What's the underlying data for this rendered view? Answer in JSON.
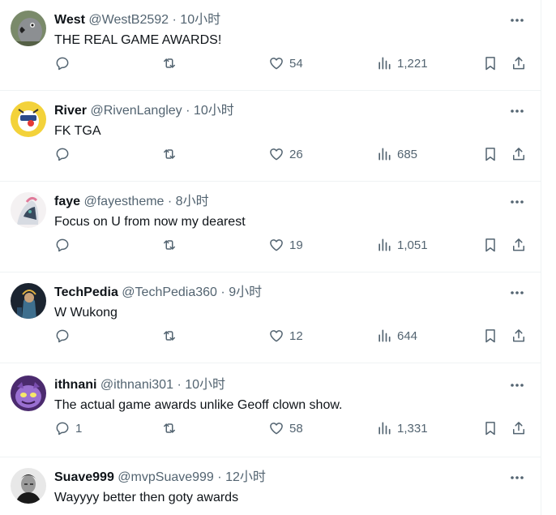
{
  "colors": {
    "text": "#0f1419",
    "secondary": "#536471",
    "divider": "#eff3f4"
  },
  "replies": [
    {
      "name": "West",
      "handle": "@WestB2592",
      "dot": "·",
      "time": "10小时",
      "text": "THE REAL GAME AWARDS!",
      "reply_count": "",
      "likes": "54",
      "views": "1,221",
      "avatar": "gray-parrot-avatar"
    },
    {
      "name": "River",
      "handle": "@RivenLangley",
      "dot": "·",
      "time": "10小时",
      "text": "FK TGA",
      "reply_count": "",
      "likes": "26",
      "views": "685",
      "avatar": "yellow-cartoon-avatar"
    },
    {
      "name": "faye",
      "handle": "@fayestheme",
      "dot": "·",
      "time": "8小时",
      "text": "Focus on U from now my dearest",
      "reply_count": "",
      "likes": "19",
      "views": "1,051",
      "avatar": "anime-character-avatar"
    },
    {
      "name": "TechPedia",
      "handle": "@TechPedia360",
      "dot": "·",
      "time": "9小时",
      "text": "W Wukong",
      "reply_count": "",
      "likes": "12",
      "views": "644",
      "avatar": "game-character-avatar"
    },
    {
      "name": "ithnani",
      "handle": "@ithnani301",
      "dot": "·",
      "time": "10小时",
      "text": "The actual game awards unlike Geoff clown show.",
      "reply_count": "1",
      "likes": "58",
      "views": "1,331",
      "avatar": "purple-creature-avatar"
    },
    {
      "name": "Suave999",
      "handle": "@mvpSuave999",
      "dot": "·",
      "time": "12小时",
      "text": "Wayyyy better then goty awards",
      "reply_count": "",
      "likes": "",
      "views": "",
      "avatar": "black-white-portrait-avatar"
    }
  ]
}
